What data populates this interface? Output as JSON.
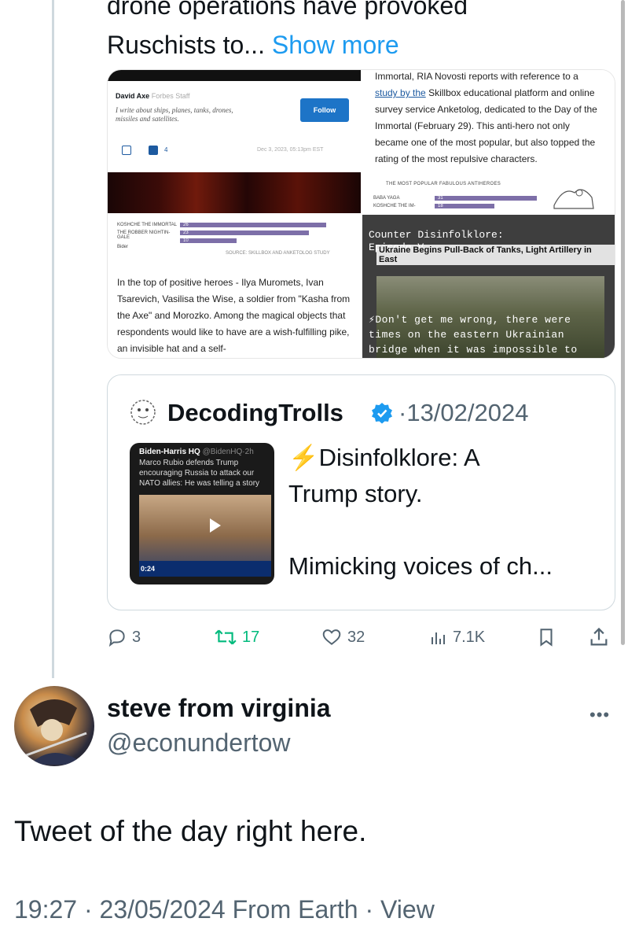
{
  "post": {
    "text_line1": "drone operations have provoked",
    "text_line2": "Ruschists to...",
    "show_more": "Show more"
  },
  "media": {
    "tile1": {
      "author": "David Axe",
      "author_sub": "Forbes Staff",
      "bio": "I write about ships, planes, tanks, drones, missiles and satellites.",
      "follow": "Follow",
      "date": "Dec 3, 2023, 05:13pm EST",
      "count": "4"
    },
    "tile2": {
      "body_pre": "Immortal, RIA Novosti reports with reference to a",
      "link": "study by the",
      "body_post": "Skillbox educational platform and online survey service Anketolog, dedicated to the Day of the Immortal (February 29). This anti-hero not only became one of the most popular, but also topped the rating of the most repulsive characters.",
      "chart_title": "THE MOST POPULAR FABULOUS ANTIHEROES",
      "bars": [
        {
          "label": "BABA YAGA",
          "value": "31"
        },
        {
          "label": "KOSHCHE THE IM-",
          "value": "18"
        }
      ]
    },
    "tile3": {
      "bars": [
        {
          "label": "KOSHCHE THE IMMORTAL",
          "value": "26"
        },
        {
          "label": "THE ROBBER NIGHTIN-GALE",
          "value": "23"
        },
        {
          "label": "Bider",
          "value": "10"
        }
      ],
      "source": "SOURCE: SKILLBOX AND ANKETOLOG STUDY",
      "body": "In the top of positive heroes - Ilya Muromets, Ivan Tsarevich, Vasilisa the Wise, a soldier from \"Kasha from the Axe\" and Morozko. Among the magical objects that respondents would like to have are a wish-fulfilling pike, an invisible hat and a self-"
    },
    "tile4": {
      "header1": "Counter Disinfolklore:",
      "header2": "Episode V",
      "news_title": "Ukraine Begins Pull-Back of Tanks, Light Artillery in East",
      "quote": "⚡Don't get me wrong, there were times on the eastern Ukrainian bridge when it was impossible to tell whether or not explosions"
    }
  },
  "quote_tweet": {
    "name": "DecodingTrolls",
    "date": "·13/02/2024",
    "thumb_head": "Biden-Harris HQ",
    "thumb_handle": "@BidenHQ·2h",
    "thumb_line1": "Marco Rubio defends Trump",
    "thumb_line2": "encouraging Russia to attack our",
    "thumb_line3": "NATO allies: He was telling a story",
    "duration": "0:24",
    "text_line1": "Disinfolklore: A",
    "text_line2": "Trump story.",
    "text_line3": "Mimicking voices of ch..."
  },
  "actions": {
    "replies": "3",
    "retweets": "17",
    "likes": "32",
    "views": "7.1K"
  },
  "reply": {
    "name": "steve from virginia",
    "handle": "@econundertow",
    "text": "Tweet of the day right here.",
    "meta": "19:27 · 23/05/2024 From Earth · View"
  },
  "colors": {
    "link": "#1d9bf0",
    "retweet": "#00ba7c",
    "muted": "#536471"
  }
}
